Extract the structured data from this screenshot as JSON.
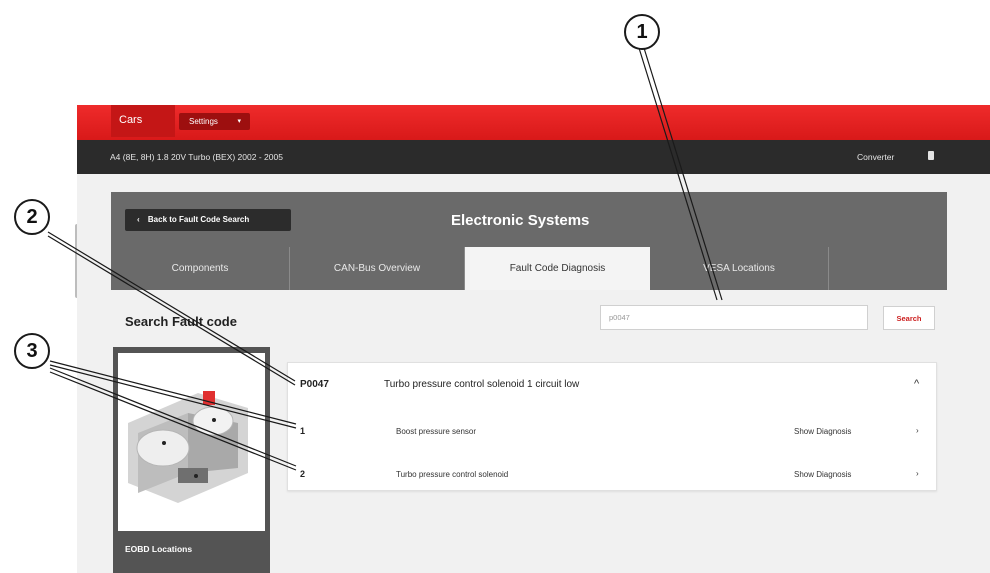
{
  "topbar": {
    "brand": "Cars",
    "settings_label": "Settings",
    "settings_caret": "▾"
  },
  "vehicle": {
    "title": "A4 (8E, 8H) 1.8 20V Turbo (BEX) 2002 - 2005",
    "converter_label": "Converter"
  },
  "systems": {
    "back_icon": "‹",
    "back_label": "Back to Fault Code Search",
    "title": "Electronic Systems",
    "tabs": [
      {
        "label": "Components"
      },
      {
        "label": "CAN-Bus Overview"
      },
      {
        "label": "Fault Code Diagnosis",
        "active": true
      },
      {
        "label": "VESA Locations"
      }
    ]
  },
  "search": {
    "label": "Search Fault code",
    "value": "p0047",
    "button_label": "Search"
  },
  "eobd": {
    "label": "EOBD Locations"
  },
  "fault": {
    "code": "P0047",
    "description": "Turbo pressure control solenoid 1 circuit low",
    "collapse_icon": "^",
    "rows": [
      {
        "num": "1",
        "label": "Boost pressure sensor",
        "link": "Show Diagnosis",
        "arrow": "›"
      },
      {
        "num": "2",
        "label": "Turbo pressure control solenoid",
        "link": "Show Diagnosis",
        "arrow": "›"
      }
    ]
  },
  "callouts": {
    "c1": "1",
    "c2": "2",
    "c3": "3"
  },
  "colors": {
    "brand_red": "#e22525",
    "dark_bar": "#2b2b2b",
    "panel_gray": "#6a6a6a",
    "search_red": "#cc1e1e"
  }
}
